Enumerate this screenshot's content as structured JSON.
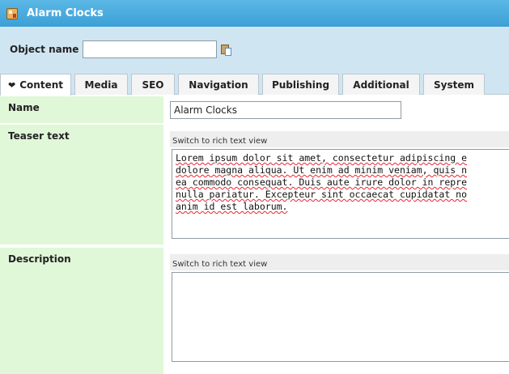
{
  "window": {
    "title": "Alarm Clocks",
    "icon": "object-icon"
  },
  "object_bar": {
    "label": "Object name",
    "value": ""
  },
  "tabs": [
    {
      "label": "Content",
      "active": true,
      "icon": "heart-icon"
    },
    {
      "label": "Media"
    },
    {
      "label": "SEO"
    },
    {
      "label": "Navigation"
    },
    {
      "label": "Publishing"
    },
    {
      "label": "Additional"
    },
    {
      "label": "System"
    }
  ],
  "fields": {
    "name": {
      "label": "Name",
      "value": "Alarm Clocks"
    },
    "teaser": {
      "label": "Teaser text",
      "toolbar": "Switch to rich text view",
      "lines": [
        "Lorem ipsum dolor sit amet, consectetur adipiscing e",
        "dolore magna aliqua. Ut enim ad minim veniam, quis n",
        "ea commodo consequat. Duis aute irure dolor in repre",
        "nulla pariatur. Excepteur sint occaecat cupidatat no",
        "anim id est laborum."
      ]
    },
    "description": {
      "label": "Description",
      "toolbar": "Switch to rich text view",
      "value": ""
    }
  }
}
